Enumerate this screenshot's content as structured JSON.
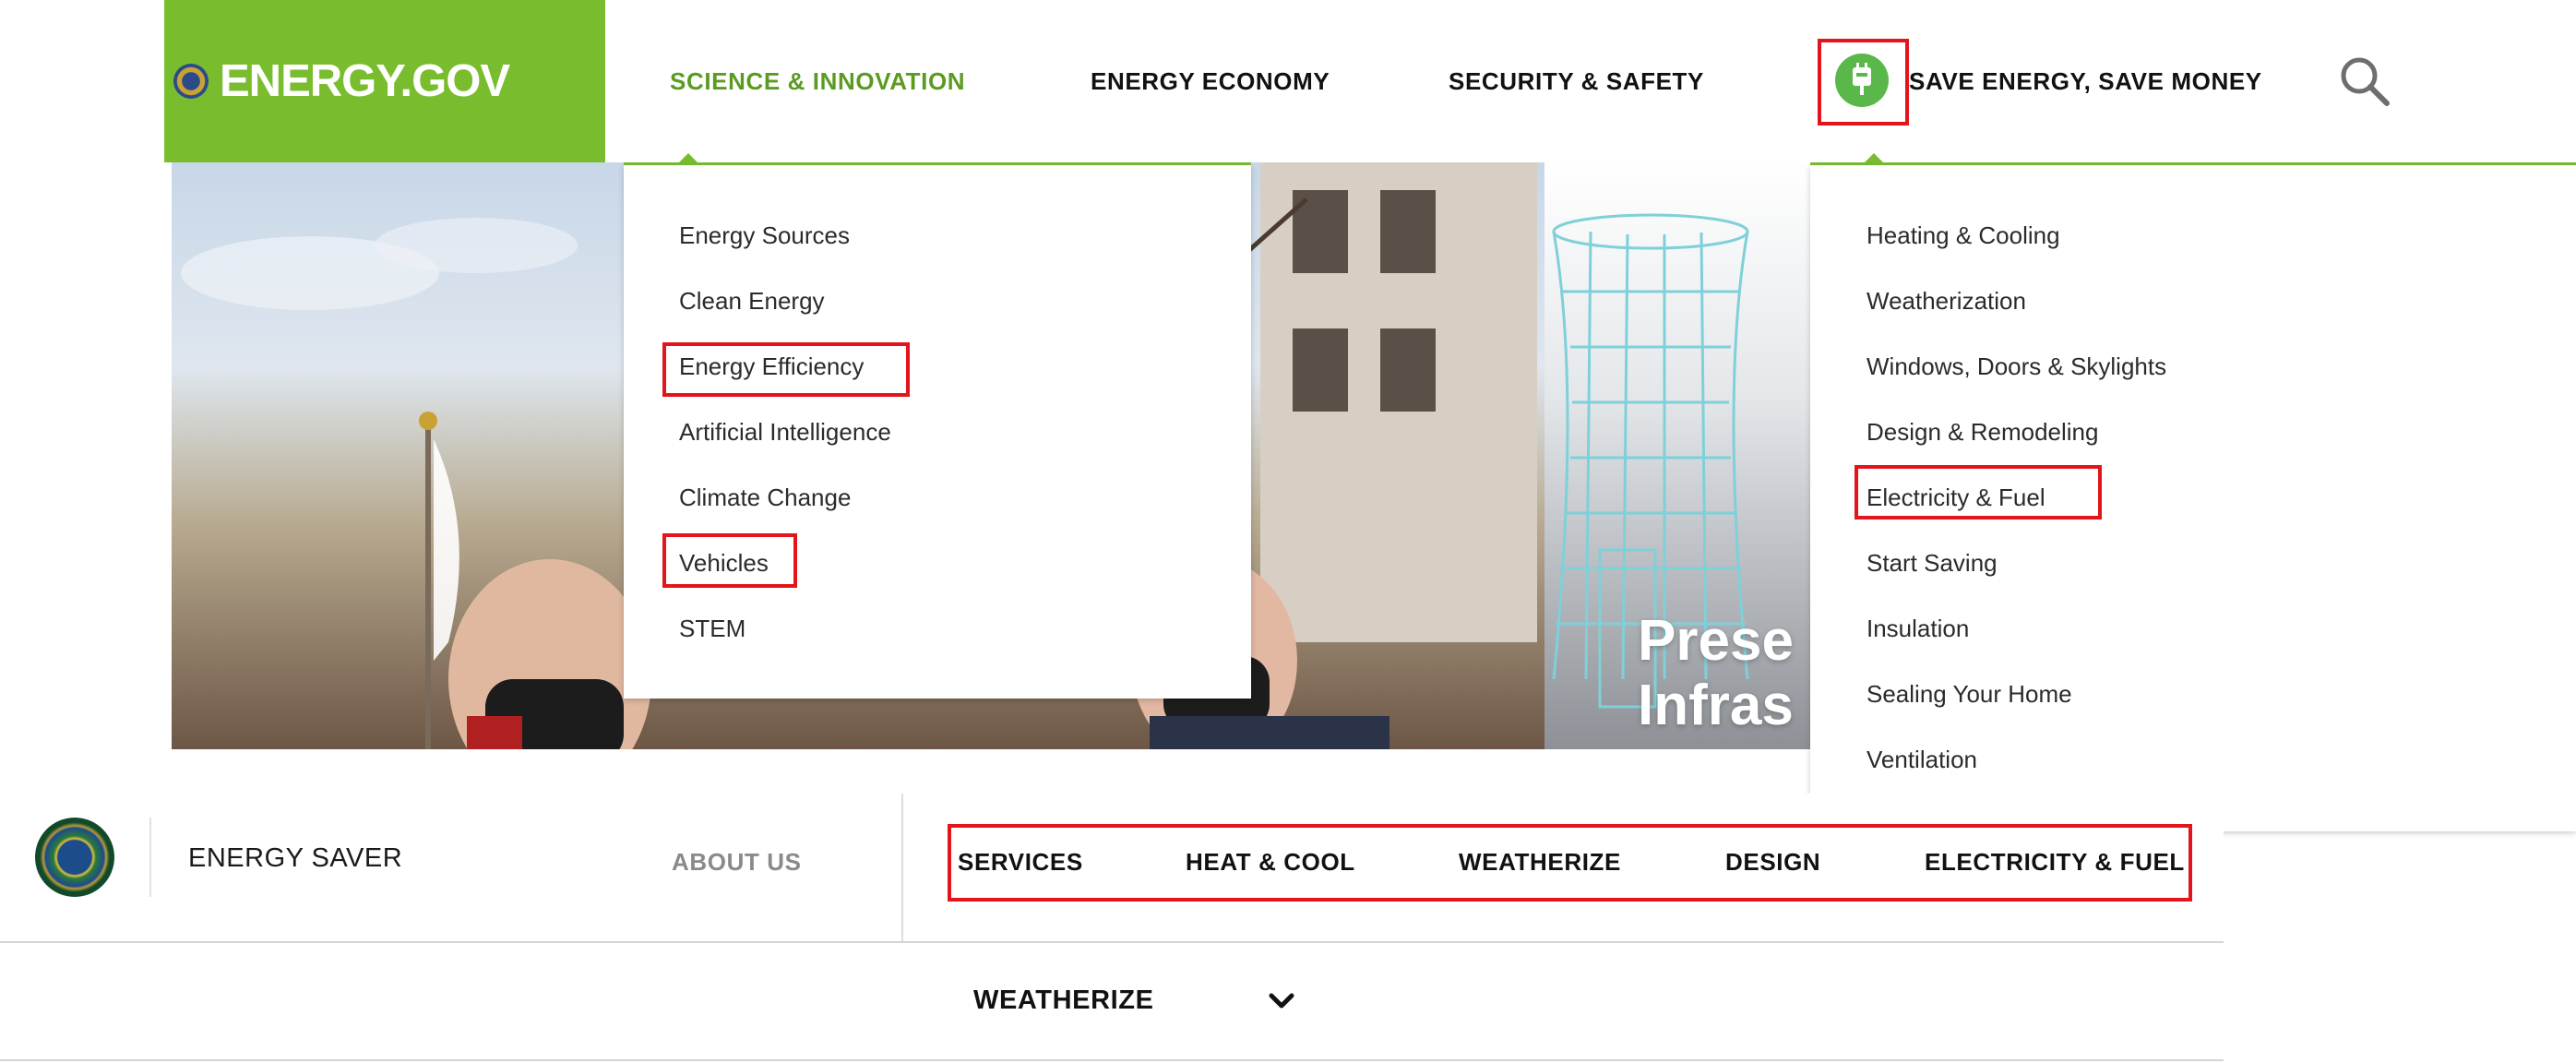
{
  "header": {
    "logo_text": "ENERGY.GOV",
    "nav": [
      {
        "label": "SCIENCE & INNOVATION"
      },
      {
        "label": "ENERGY ECONOMY"
      },
      {
        "label": "SECURITY & SAFETY"
      },
      {
        "label": "SAVE ENERGY, SAVE MONEY"
      }
    ],
    "icons": {
      "plug": "plug-icon",
      "search": "search-icon"
    },
    "colors": {
      "brand_green": "#79bd2f",
      "active_nav": "#5b9b21",
      "highlight_red": "#e3141b"
    }
  },
  "science_menu": {
    "items": [
      "Energy Sources",
      "Clean Energy",
      "Energy Efficiency",
      "Artificial Intelligence",
      "Climate Change",
      "Vehicles",
      "STEM"
    ]
  },
  "save_menu": {
    "items": [
      "Heating & Cooling",
      "Weatherization",
      "Windows, Doors & Skylights",
      "Design & Remodeling",
      "Electricity & Fuel",
      "Start Saving",
      "Insulation",
      "Sealing Your Home",
      "Ventilation"
    ]
  },
  "hero": {
    "title_line1": "Prese",
    "title_line2": "Infras"
  },
  "energy_saver": {
    "title": "ENERGY SAVER",
    "about": "ABOUT US",
    "nav": [
      "SERVICES",
      "HEAT & COOL",
      "WEATHERIZE",
      "DESIGN",
      "ELECTRICITY & FUEL"
    ]
  },
  "section_selector": {
    "label": "WEATHERIZE",
    "icon": "chevron-down-icon"
  }
}
